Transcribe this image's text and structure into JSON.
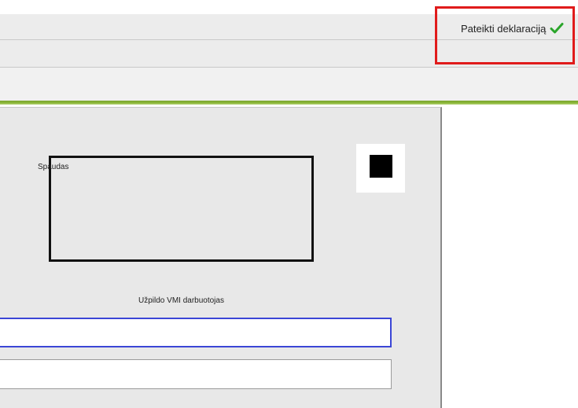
{
  "header": {
    "submit_label": "Pateikti deklaraciją",
    "submit_icon": "check-icon",
    "highlight_color": "#e01b1b",
    "accent_color": "#8cb83a"
  },
  "form": {
    "stamp_label": "Spaudas",
    "stamp_caption": "Užpildo VMI darbuotojas",
    "focus_color": "#3b46d6"
  }
}
